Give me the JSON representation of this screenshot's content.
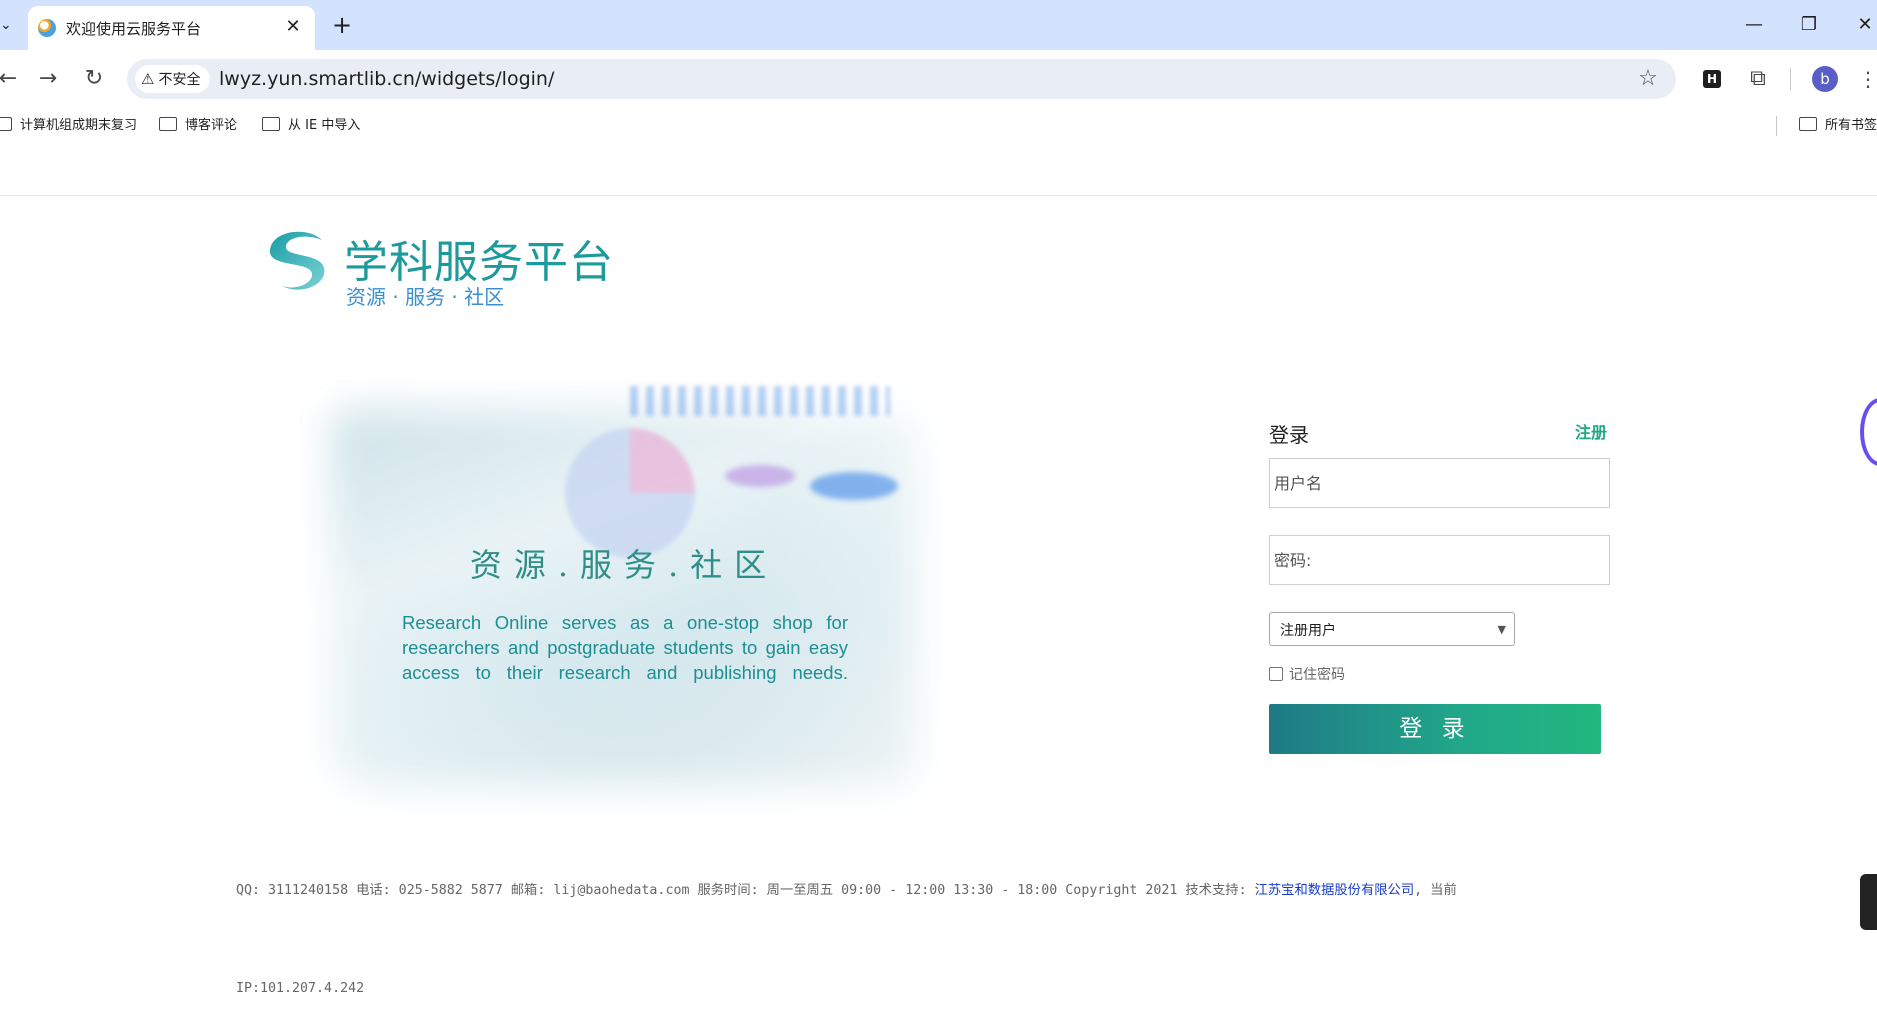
{
  "browser": {
    "tab_title": "欢迎使用云服务平台",
    "tab_close": "✕",
    "new_tab": "+",
    "security_label": "不安全",
    "url": "lwyz.yun.smartlib.cn/widgets/login/",
    "extension_badge": "H",
    "profile_initial": "b",
    "window_controls": {
      "minimize": "—",
      "restore": "❐",
      "close": "✕"
    },
    "bookmarks": [
      "计算机组成期末复习",
      "博客评论",
      "从 IE 中导入"
    ],
    "all_bookmarks_label": "所有书签"
  },
  "logo": {
    "title": "学科服务平台",
    "slogan": "资源 · 服务 · 社区"
  },
  "hero": {
    "slogan": "资源.服务.社区",
    "description": "Research Online serves as a one-stop shop for researchers and postgraduate students to gain easy access to their research and publishing needs."
  },
  "login": {
    "title": "登录",
    "register_link": "注册",
    "username_placeholder": "用户名",
    "password_placeholder": "密码:",
    "user_type_selected": "注册用户",
    "remember_label": "记住密码",
    "submit_label": "登 录"
  },
  "footer": {
    "contact_text": "QQ: 3111240158 电话: 025-5882 5877 邮箱: lij@baohedata.com 服务时间: 周一至周五 09:00 - 12:00 13:30 - 18:00 Copyright 2021 技术支持: ",
    "company": "江苏宝和数据股份有限公司",
    "trailing": ", 当前",
    "ip": "IP:101.207.4.242"
  },
  "colors": {
    "accent": "#1d9a9b",
    "login_button_start": "#1f7a86",
    "login_button_end": "#22b77e",
    "register_link": "#1ea886",
    "company_link": "#1a3ccc"
  }
}
